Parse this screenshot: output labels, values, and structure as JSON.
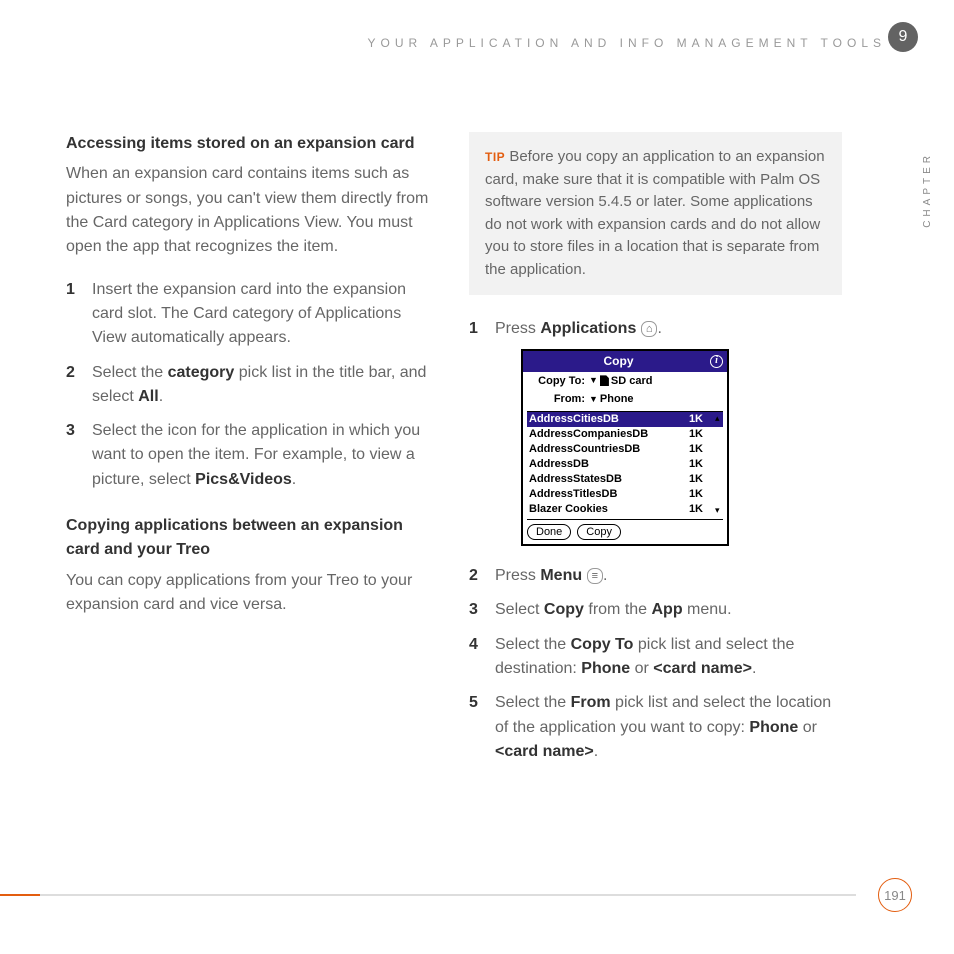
{
  "header": "YOUR APPLICATION AND INFO MANAGEMENT TOOLS",
  "chapter_num": "9",
  "side_label": "CHAPTER",
  "page_number": "191",
  "left": {
    "h1": "Accessing items stored on an expansion card",
    "p1": "When an expansion card contains items such as pictures or songs, you can't view them directly from the Card category in Applications View. You must open the app that recognizes the item.",
    "s1": "Insert the expansion card into the expansion card slot. The Card category of Applications View automatically appears.",
    "s2a": "Select the ",
    "s2b": "category",
    "s2c": " pick list in the title bar, and select ",
    "s2d": "All",
    "s2e": ".",
    "s3a": "Select the icon for the application in which you want to open the item. For example, to view a picture, select ",
    "s3b": "Pics&Videos",
    "s3c": ".",
    "h2": "Copying applications between an expansion card and your Treo",
    "p2": "You can copy applications from your Treo to your expansion card and vice versa."
  },
  "tip": {
    "label": "TIP",
    "body": " Before you copy an application to an expansion card, make sure that it is compatible with Palm OS software version 5.4.5 or later. Some applications do not work with expansion cards and do not allow you to store files in a location that is separate from the application."
  },
  "right": {
    "s1a": "Press ",
    "s1b": "Applications",
    "s1c": " ",
    "s1d": ".",
    "s2a": "Press ",
    "s2b": "Menu",
    "s2c": " ",
    "s2d": ".",
    "s3a": "Select ",
    "s3b": "Copy",
    "s3c": " from the ",
    "s3d": "App",
    "s3e": " menu.",
    "s4a": "Select the ",
    "s4b": "Copy To",
    "s4c": " pick list and select the destination: ",
    "s4d": "Phone",
    "s4e": " or ",
    "s4f": "<card name>",
    "s4g": ".",
    "s5a": "Select the ",
    "s5b": "From",
    "s5c": " pick list and select the location of the application you want to copy: ",
    "s5d": "Phone",
    "s5e": " or ",
    "s5f": "<card name>",
    "s5g": "."
  },
  "palm": {
    "title": "Copy",
    "copy_to_label": "Copy To:",
    "copy_to_value": "SD card",
    "from_label": "From:",
    "from_value": "Phone",
    "rows": [
      {
        "name": "AddressCitiesDB",
        "size": "1K"
      },
      {
        "name": "AddressCompaniesDB",
        "size": "1K"
      },
      {
        "name": "AddressCountriesDB",
        "size": "1K"
      },
      {
        "name": "AddressDB",
        "size": "1K"
      },
      {
        "name": "AddressStatesDB",
        "size": "1K"
      },
      {
        "name": "AddressTitlesDB",
        "size": "1K"
      },
      {
        "name": "Blazer Cookies",
        "size": "1K"
      }
    ],
    "btn_done": "Done",
    "btn_copy": "Copy"
  },
  "icons": {
    "home": "⌂",
    "menu": "≡"
  }
}
